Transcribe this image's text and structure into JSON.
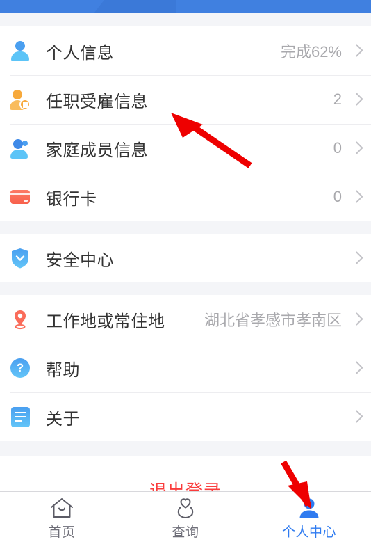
{
  "header": {
    "bar_color": "#4080e0"
  },
  "list": {
    "groups": [
      {
        "name": "profile-group",
        "rows": [
          {
            "icon": "person-icon",
            "label": "个人信息",
            "value": "完成62%",
            "chevron": true
          },
          {
            "icon": "employment-person-icon",
            "label": "任职受雇信息",
            "value": "2",
            "chevron": true
          },
          {
            "icon": "family-members-icon",
            "label": "家庭成员信息",
            "value": "0",
            "chevron": true
          },
          {
            "icon": "bank-card-icon",
            "label": "银行卡",
            "value": "0",
            "chevron": true
          }
        ]
      },
      {
        "name": "security-group",
        "rows": [
          {
            "icon": "shield-icon",
            "label": "安全中心",
            "value": "",
            "chevron": true
          }
        ]
      },
      {
        "name": "settings-group",
        "rows": [
          {
            "icon": "location-pin-icon",
            "label": "工作地或常住地",
            "value": "湖北省孝感市孝南区",
            "chevron": true
          },
          {
            "icon": "help-icon",
            "label": "帮助",
            "value": "",
            "chevron": true
          },
          {
            "icon": "about-icon",
            "label": "关于",
            "value": "",
            "chevron": true
          }
        ]
      }
    ]
  },
  "logout": {
    "label": "退出登录",
    "color": "#fa3c3c"
  },
  "tabbar": {
    "active_color": "#2f7bf0",
    "inactive_color": "#6e6e78",
    "tabs": [
      {
        "icon": "home-icon",
        "label": "首页",
        "active": false
      },
      {
        "icon": "search-icon",
        "label": "查询",
        "active": false
      },
      {
        "icon": "person-icon",
        "label": "个人中心",
        "active": true
      }
    ]
  },
  "annotations": {
    "color": "#ee0000",
    "arrows": [
      {
        "name": "arrow-to-employment-row",
        "target": "任职受雇信息"
      },
      {
        "name": "arrow-to-profile-tab",
        "target": "个人中心"
      }
    ]
  }
}
